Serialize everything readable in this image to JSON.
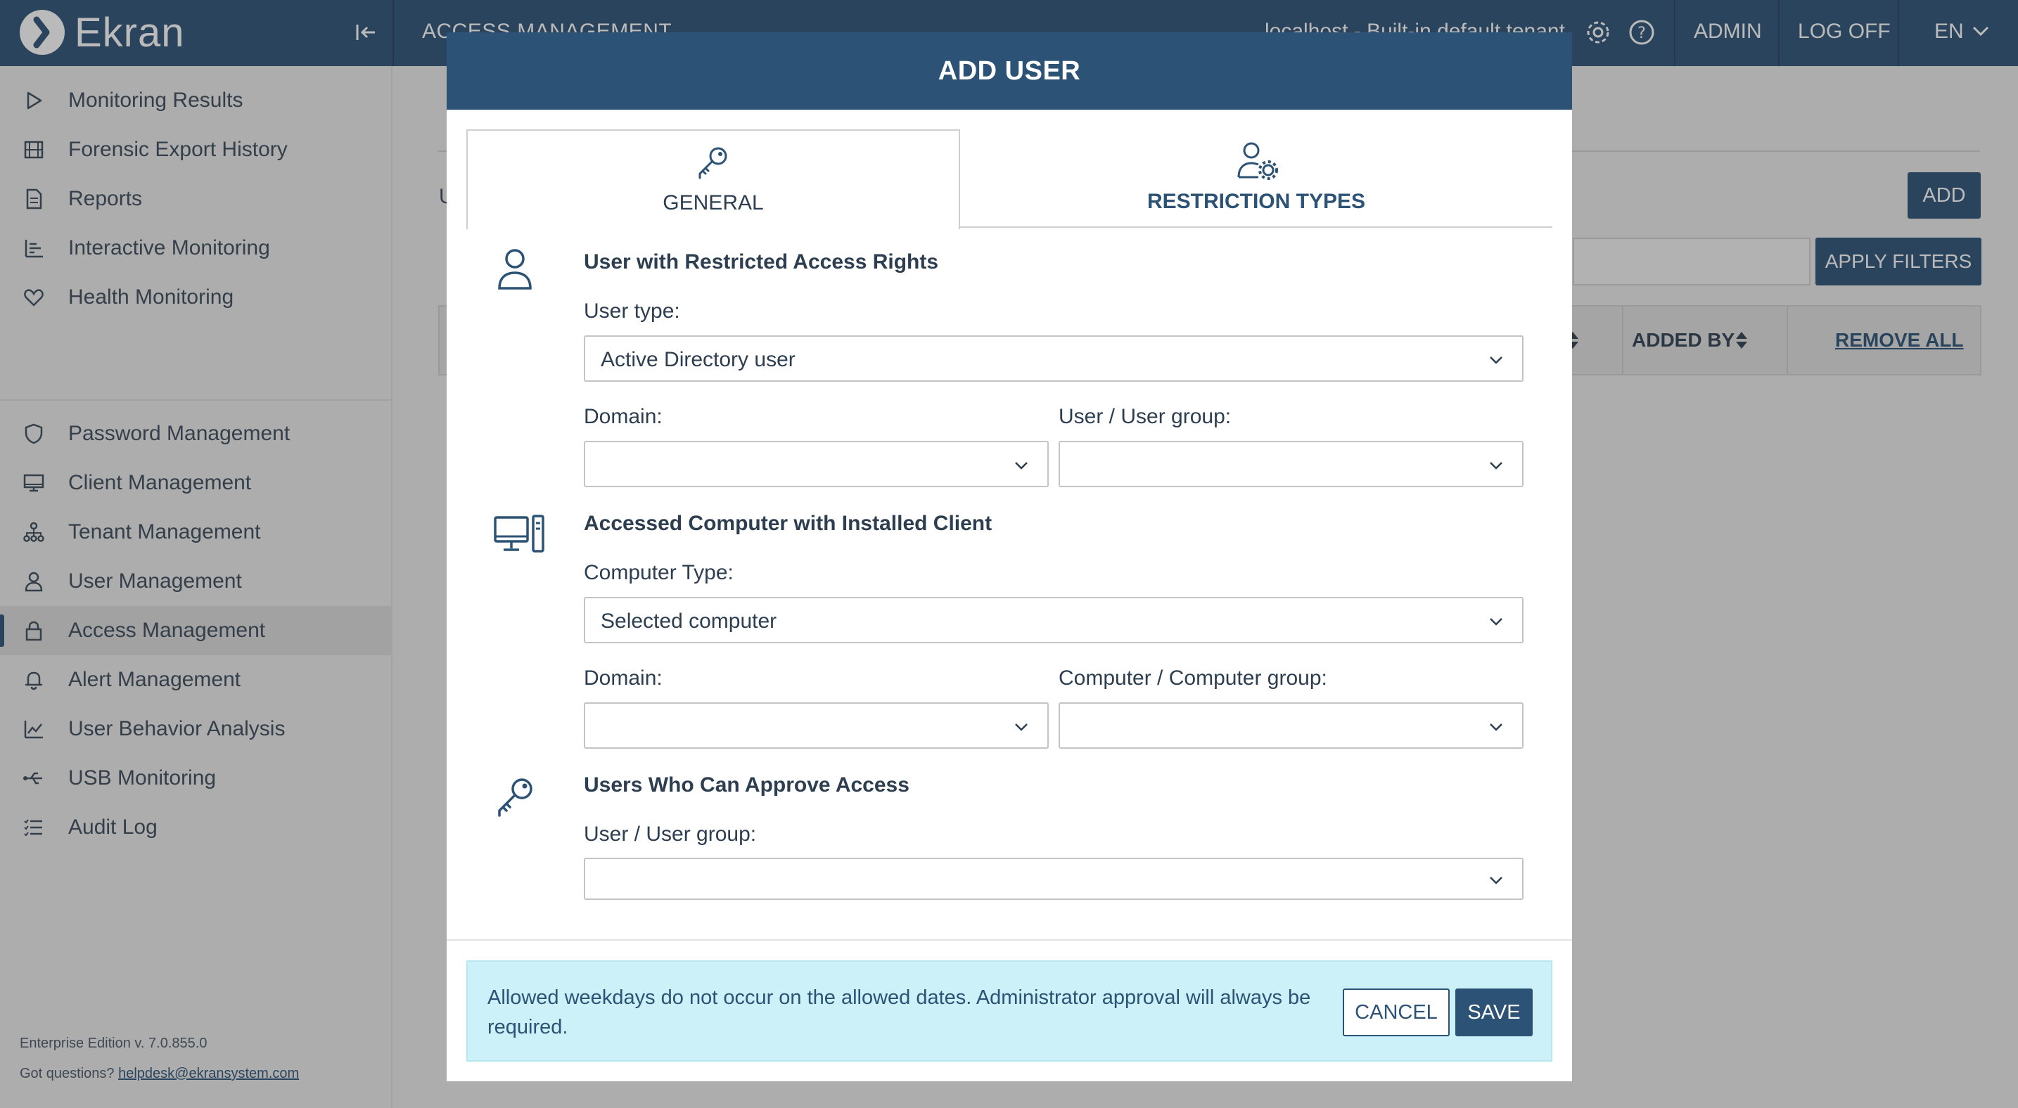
{
  "app": {
    "logo_text": "Ekran",
    "page_title": "ACCESS MANAGEMENT",
    "tenant_info": "localhost - Built-in default tenant",
    "user": "ADMIN",
    "logoff": "LOG OFF",
    "language": "EN"
  },
  "sidebar": {
    "items": [
      {
        "label": "Monitoring Results",
        "icon": "play-icon"
      },
      {
        "label": "Forensic Export History",
        "icon": "film-icon"
      },
      {
        "label": "Reports",
        "icon": "document-icon"
      },
      {
        "label": "Interactive Monitoring",
        "icon": "bar-chart-icon"
      },
      {
        "label": "Health Monitoring",
        "icon": "heart-icon"
      },
      {
        "label": "Password Management",
        "icon": "shield-icon"
      },
      {
        "label": "Client Management",
        "icon": "monitor-icon"
      },
      {
        "label": "Tenant Management",
        "icon": "hierarchy-icon"
      },
      {
        "label": "User Management",
        "icon": "user-icon"
      },
      {
        "label": "Access Management",
        "icon": "lock-icon",
        "active": true
      },
      {
        "label": "Alert Management",
        "icon": "bell-icon"
      },
      {
        "label": "User Behavior Analysis",
        "icon": "line-chart-icon"
      },
      {
        "label": "USB Monitoring",
        "icon": "usb-icon"
      },
      {
        "label": "Audit Log",
        "icon": "list-icon"
      }
    ],
    "edition": "Enterprise Edition v. 7.0.855.0",
    "questions_prefix": "Got questions? ",
    "helpdesk_email": "helpdesk@ekransystem.com"
  },
  "background": {
    "partial_text": "U",
    "add_label": "ADD",
    "apply_filters_label": "APPLY FILTERS",
    "added_by_header": "ADDED BY",
    "remove_all_label": "REMOVE ALL"
  },
  "modal": {
    "title": "ADD USER",
    "tabs": [
      {
        "label": "GENERAL",
        "icon": "key-icon",
        "active": true
      },
      {
        "label": "RESTRICTION TYPES",
        "icon": "user-settings-icon",
        "active": false
      }
    ],
    "section_user": {
      "title": "User with Restricted Access Rights",
      "user_type_label": "User type:",
      "user_type_value": "Active Directory user",
      "domain_label": "Domain:",
      "domain_value": "",
      "user_group_label": "User / User group:",
      "user_group_value": ""
    },
    "section_computer": {
      "title": "Accessed Computer with Installed Client",
      "computer_type_label": "Computer Type:",
      "computer_type_value": "Selected computer",
      "domain_label": "Domain:",
      "domain_value": "",
      "computer_group_label": "Computer / Computer group:",
      "computer_group_value": ""
    },
    "section_approvers": {
      "title": "Users Who Can Approve Access",
      "user_group_label": "User / User group:",
      "user_group_value": ""
    },
    "alert_text": "Allowed weekdays do not occur on the allowed dates. Administrator approval will always be required.",
    "cancel_label": "CANCEL",
    "save_label": "SAVE"
  },
  "colors": {
    "primary": "#2c5276",
    "alert_bg": "#ccf1f8",
    "sidebar_bg": "#ececec"
  }
}
